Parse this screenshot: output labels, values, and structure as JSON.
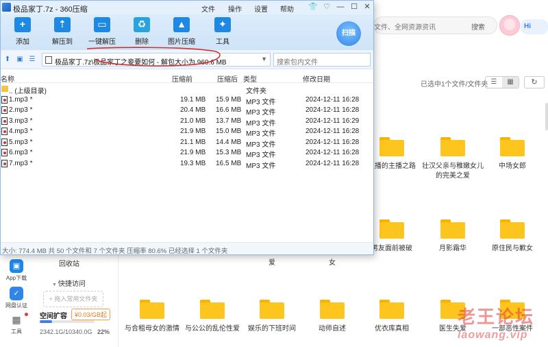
{
  "zip_window": {
    "title": "极品家丁.7z - 360压缩",
    "menu": [
      "文件",
      "操作",
      "设置",
      "帮助"
    ],
    "toolbar": [
      {
        "label": "添加",
        "icon": "add-icon",
        "color": "#1e88e5"
      },
      {
        "label": "解压到",
        "icon": "extract-to-icon",
        "color": "#1e88e5"
      },
      {
        "label": "一键解压",
        "icon": "one-click-extract-icon",
        "color": "#1e88e5"
      },
      {
        "label": "删除",
        "icon": "delete-icon",
        "color": "#1e88e5"
      },
      {
        "label": "图片压缩",
        "icon": "image-compress-icon",
        "color": "#1e88e5"
      },
      {
        "label": "工具",
        "icon": "tools-icon",
        "color": "#1e88e5"
      }
    ],
    "scan_label": "扫描",
    "address": "极品家丁.7z\\极品家丁之妾要如何 - 解包大小为 960.6 MB",
    "search_placeholder": "搜索包内文件",
    "columns": {
      "name": "名称",
      "size_before": "压缩前",
      "size_after": "压缩后",
      "type": "类型",
      "modified": "修改日期"
    },
    "parent_dir": {
      "name": ".. (上级目录)",
      "type": "文件夹"
    },
    "files": [
      {
        "name": "1.mp3 *",
        "before": "19.1 MB",
        "after": "15.9 MB",
        "type": "MP3 文件",
        "date": "2024-12-11 16:28"
      },
      {
        "name": "2.mp3 *",
        "before": "20.4 MB",
        "after": "16.6 MB",
        "type": "MP3 文件",
        "date": "2024-12-11 16:28"
      },
      {
        "name": "3.mp3 *",
        "before": "21.0 MB",
        "after": "13.7 MB",
        "type": "MP3 文件",
        "date": "2024-12-11 16:29"
      },
      {
        "name": "4.mp3 *",
        "before": "21.9 MB",
        "after": "15.0 MB",
        "type": "MP3 文件",
        "date": "2024-12-11 16:28"
      },
      {
        "name": "5.mp3 *",
        "before": "21.1 MB",
        "after": "14.4 MB",
        "type": "MP3 文件",
        "date": "2024-12-11 16:28"
      },
      {
        "name": "6.mp3 *",
        "before": "21.9 MB",
        "after": "15.3 MB",
        "type": "MP3 文件",
        "date": "2024-12-11 16:28"
      },
      {
        "name": "7.mp3 *",
        "before": "19.3 MB",
        "after": "16.5 MB",
        "type": "MP3 文件",
        "date": "2024-12-11 16:28"
      }
    ],
    "status": "大小: 774.4 MB 共 50 个文件和 7 个文件夹 压缩率 80.6% 已经选择 1 个文件夹"
  },
  "background_app": {
    "search_text": "文件、全网资源资讯",
    "search_button": "搜索",
    "more": "···",
    "hi_label": "Hi",
    "selected_info": "已选中1个文件/文件夹",
    "folders_row1": [
      "主播的主播之路",
      "壮汉父亲与稚嫩女儿的完美之爱",
      "中场女郎"
    ],
    "folders_row2": [
      "男友面前被破",
      "月影霜华",
      "原住民与歉女"
    ],
    "partial_row2_labels": [
      "爱",
      "女"
    ],
    "folders_row3": [
      "与合租母女的激情",
      "与公公的乱伦性爱",
      "娱乐的下班时间",
      "动师自述",
      "优衣库真相",
      "医生失爱",
      "一部恶性案件"
    ],
    "left_tools": [
      {
        "label": "App下载",
        "color": "#1e88e5"
      },
      {
        "label": "网盘认证",
        "color": "#2f86e8"
      },
      {
        "label": "工具",
        "color": "#555555"
      }
    ],
    "recycle": "回收站",
    "quick_access": "快捷访问",
    "drop_hint": "+ 拖入常用文件夹",
    "expand_label": "空间扩容",
    "expand_price": "¥0.03/GB起",
    "usage": "2342.1G/10340.0G",
    "usage_fraction": 0.22,
    "usage_pct": "22%",
    "watermark": "老王论坛",
    "watermark_sub": "laowang.vip"
  }
}
